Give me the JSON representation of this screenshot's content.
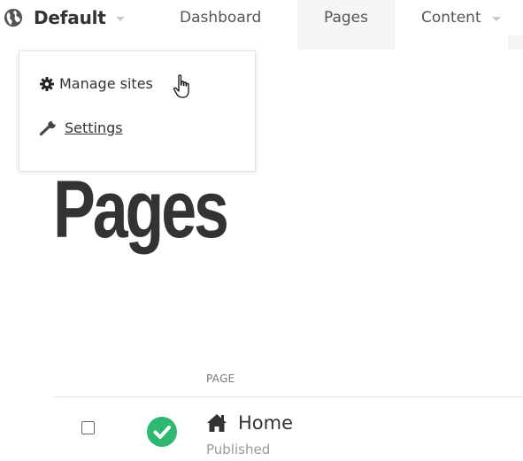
{
  "nav": {
    "site_name": "Default",
    "items": [
      {
        "label": "Dashboard"
      },
      {
        "label": "Pages"
      },
      {
        "label": "Content"
      }
    ]
  },
  "dropdown": {
    "manage_sites": "Manage sites",
    "settings": "Settings"
  },
  "page": {
    "title": "Pages"
  },
  "table": {
    "column_page": "PAGE",
    "rows": [
      {
        "title": "Home",
        "status": "Published",
        "status_icon": "check-circle-icon"
      }
    ]
  },
  "colors": {
    "success": "#2eb872",
    "active_tab_bg": "#f5f5f5",
    "text": "#333333"
  }
}
